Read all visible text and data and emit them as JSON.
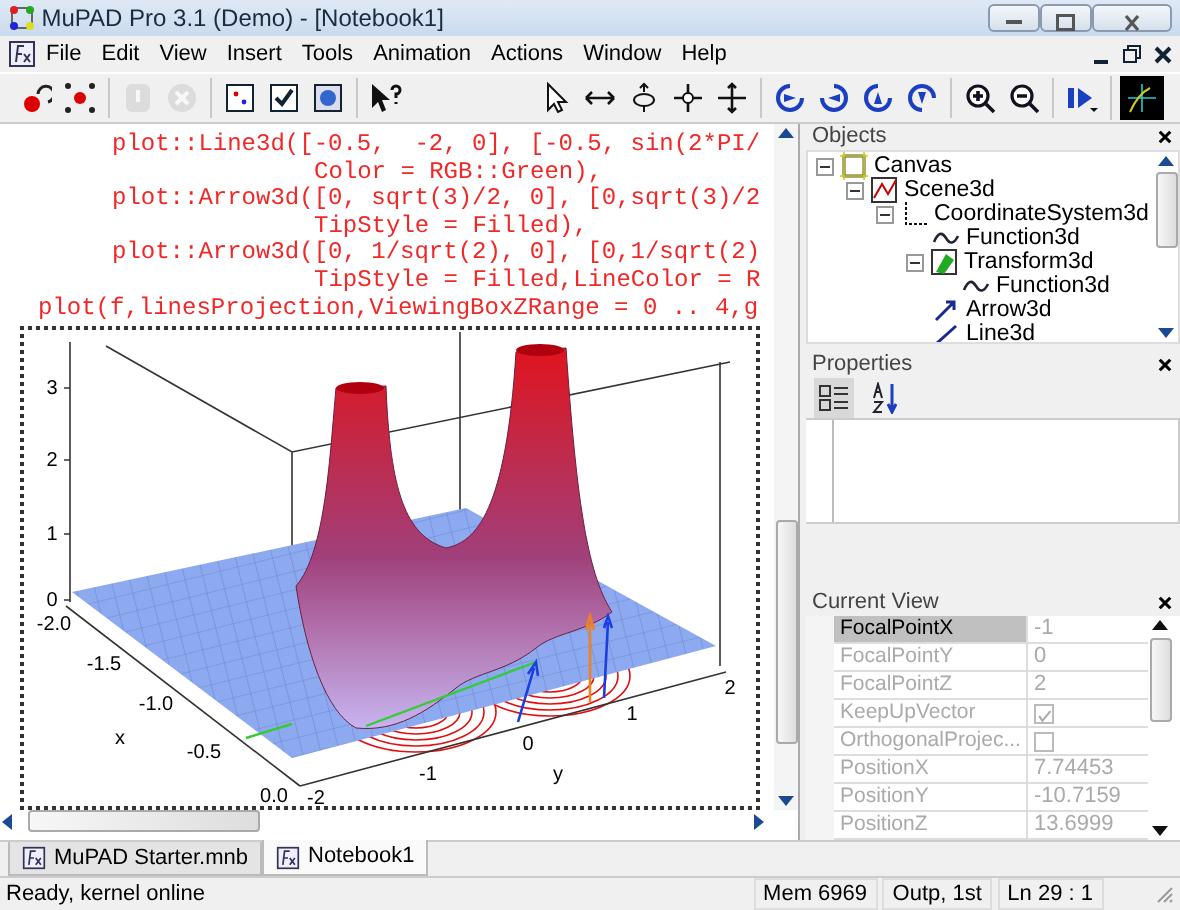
{
  "window": {
    "title": "MuPAD Pro 3.1 (Demo) - [Notebook1]"
  },
  "menu": [
    "File",
    "Edit",
    "View",
    "Insert",
    "Tools",
    "Animation",
    "Actions",
    "Window",
    "Help"
  ],
  "toolbars": [
    {
      "groups": [
        [
          {
            "kind": "record",
            "disabled": false
          },
          {
            "kind": "points",
            "disabled": false
          }
        ],
        [
          {
            "kind": "pause",
            "disabled": true
          },
          {
            "kind": "stop",
            "disabled": true
          }
        ],
        [
          {
            "kind": "frame",
            "disabled": false
          },
          {
            "kind": "check",
            "disabled": false
          },
          {
            "kind": "screen",
            "disabled": false
          }
        ],
        [
          {
            "kind": "help",
            "disabled": false
          }
        ]
      ]
    },
    {
      "groups": [
        [
          {
            "kind": "select",
            "disabled": false
          },
          {
            "kind": "move-x",
            "disabled": false
          },
          {
            "kind": "move-y",
            "disabled": false
          },
          {
            "kind": "move-xy",
            "disabled": false
          },
          {
            "kind": "move-z",
            "disabled": false
          }
        ],
        [
          {
            "kind": "rotate-left",
            "disabled": false
          },
          {
            "kind": "rotate-right",
            "disabled": false
          },
          {
            "kind": "rotate-up",
            "disabled": false
          },
          {
            "kind": "rotate-down",
            "disabled": false
          }
        ],
        [
          {
            "kind": "zoom-in",
            "disabled": false
          },
          {
            "kind": "zoom-out",
            "disabled": false
          }
        ],
        [
          {
            "kind": "play",
            "disabled": false
          }
        ],
        [
          {
            "kind": "preview",
            "disabled": false
          }
        ]
      ]
    }
  ],
  "editor": {
    "code_lines": [
      {
        "kind": "statement",
        "text": "plot::Line3d([-0.5,  -2, 0], [-0.5, sin(2*PI/"
      },
      {
        "kind": "continuation",
        "text": "Color = RGB::Green),"
      },
      {
        "kind": "statement",
        "text": "plot::Arrow3d([0, sqrt(3)/2, 0], [0,sqrt(3)/2"
      },
      {
        "kind": "continuation",
        "text": "TipStyle = Filled),"
      },
      {
        "kind": "statement",
        "text": "plot::Arrow3d([0, 1/sqrt(2), 0], [0,1/sqrt(2)"
      },
      {
        "kind": "continuation",
        "text": "TipStyle = Filled,LineColor = R"
      },
      {
        "kind": "command",
        "text": "plot(f,linesProjection,ViewingBoxZRange = 0 .. 4,g"
      }
    ],
    "plot": {
      "z_ticks": [
        "3",
        "2",
        "1",
        "0"
      ],
      "x_ticks": [
        "-2.0",
        "-1.5",
        "-1.0",
        "-0.5",
        "0.0"
      ],
      "x_label": "x",
      "y_ticks": [
        "-2",
        "-1",
        "0",
        "1",
        "2"
      ],
      "y_label": "y"
    }
  },
  "objects": {
    "title": "Objects",
    "tree": [
      {
        "label": "Canvas",
        "kind": "canvas",
        "expanded": true,
        "children": [
          {
            "label": "Scene3d",
            "kind": "scene",
            "expanded": true,
            "children": [
              {
                "label": "CoordinateSystem3d",
                "kind": "axes",
                "expanded": true,
                "children": [
                  {
                    "label": "Function3d",
                    "kind": "function"
                  },
                  {
                    "label": "Transform3d",
                    "kind": "transform",
                    "expanded": true,
                    "children": [
                      {
                        "label": "Function3d",
                        "kind": "function"
                      }
                    ]
                  },
                  {
                    "label": "Arrow3d",
                    "kind": "arrow"
                  },
                  {
                    "label": "Line3d",
                    "kind": "line"
                  }
                ]
              }
            ]
          }
        ]
      }
    ]
  },
  "properties": {
    "title": "Properties"
  },
  "current_view": {
    "title": "Current View",
    "rows": [
      {
        "name": "FocalPointX",
        "kind": "text",
        "value": "-1",
        "selected": true
      },
      {
        "name": "FocalPointY",
        "kind": "text",
        "value": "0",
        "selected": false
      },
      {
        "name": "FocalPointZ",
        "kind": "text",
        "value": "2",
        "selected": false
      },
      {
        "name": "KeepUpVector",
        "kind": "checkbox",
        "checked": true,
        "selected": false
      },
      {
        "name": "OrthogonalProjec...",
        "kind": "checkbox",
        "checked": false,
        "selected": false
      },
      {
        "name": "PositionX",
        "kind": "text",
        "value": "7.74453",
        "selected": false
      },
      {
        "name": "PositionY",
        "kind": "text",
        "value": "-10.7159",
        "selected": false
      },
      {
        "name": "PositionZ",
        "kind": "text",
        "value": "13.6999",
        "selected": false
      }
    ]
  },
  "document_tabs": [
    {
      "label": "MuPAD Starter.mnb",
      "selected": false
    },
    {
      "label": "Notebook1",
      "selected": true
    }
  ],
  "status_bar": {
    "message": "Ready, kernel online",
    "memory": "Mem 6969",
    "output": "Outp, 1st",
    "position": "Ln 29 : 1"
  }
}
